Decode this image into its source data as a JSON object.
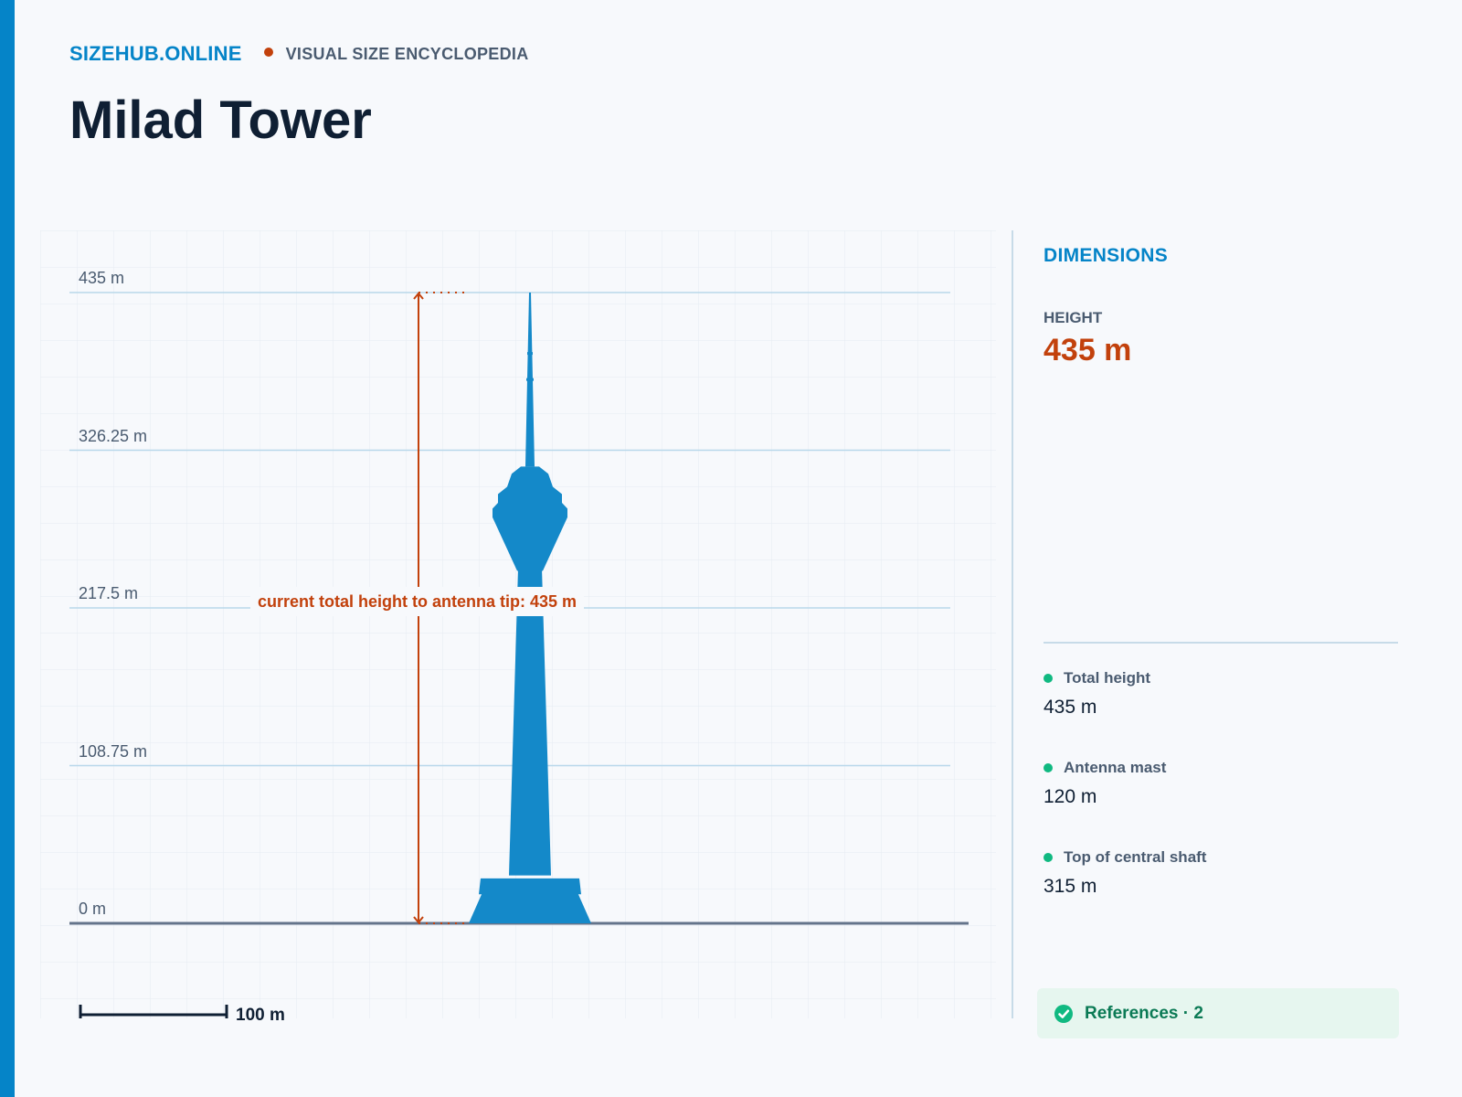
{
  "header": {
    "brand": "SIZEHUB.ONLINE",
    "tagline": "VISUAL SIZE ENCYCLOPEDIA",
    "title": "Milad Tower"
  },
  "colors": {
    "accent": "#0584c8",
    "highlight": "#c2410c",
    "tower": "#1489c9",
    "success": "#10b981"
  },
  "chart_data": {
    "type": "diagram",
    "unit": "m",
    "y_ticks": [
      "435 m",
      "326.25 m",
      "217.5 m",
      "108.75 m",
      "0 m"
    ],
    "annotation": "current total height to antenna tip: 435 m",
    "total_height": 435,
    "scale_bar": {
      "value": 100,
      "label": "100 m"
    }
  },
  "panel": {
    "title": "DIMENSIONS",
    "height_label": "HEIGHT",
    "height_value": "435 m",
    "items": [
      {
        "name": "Total height",
        "value": "435 m"
      },
      {
        "name": "Antenna mast",
        "value": "120 m"
      },
      {
        "name": "Top of central shaft",
        "value": "315 m"
      }
    ],
    "references_label": "References · 2",
    "references_icon": "check-circle-icon"
  }
}
